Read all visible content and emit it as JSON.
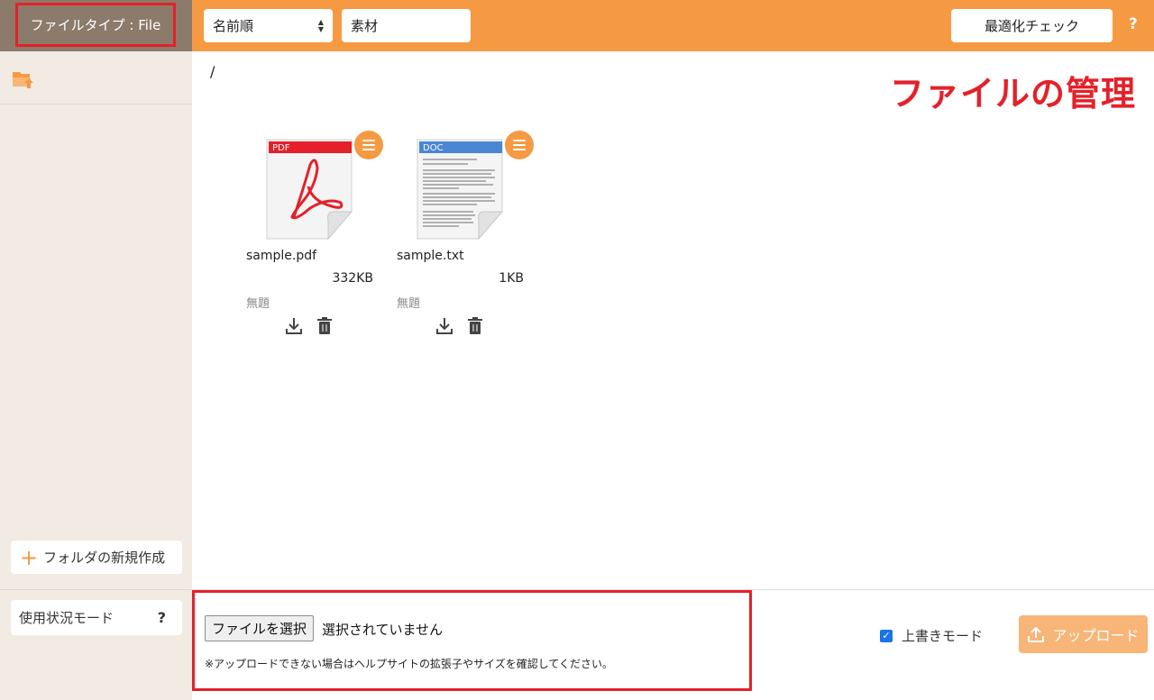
{
  "sidebar": {
    "file_type_label": "ファイルタイプ : File",
    "upload_folder_icon": "folder-upload-icon",
    "new_folder_label": "フォルダの新規作成",
    "usage_mode_label": "使用状況モード",
    "usage_help": "?"
  },
  "toolbar": {
    "sort_value": "名前順",
    "filter_value": "素材",
    "optimize_label": "最適化チェック",
    "help": "?"
  },
  "main": {
    "path": "/",
    "heading": "ファイルの管理",
    "files": [
      {
        "name": "sample.pdf",
        "size": "332KB",
        "title": "無題",
        "thumb_label": "PDF",
        "icon": "pdf-file-icon"
      },
      {
        "name": "sample.txt",
        "size": "1KB",
        "title": "無題",
        "thumb_label": "DOC",
        "icon": "doc-file-icon"
      }
    ]
  },
  "upload": {
    "choose_label": "ファイルを選択",
    "choose_status": "選択されていません",
    "note": "※アップロードできない場合はヘルプサイトの拡張子やサイズを確認してください。",
    "overwrite_label": "上書きモード",
    "overwrite_checked": true,
    "upload_label": "アップロード"
  },
  "colors": {
    "accent": "#f59a43",
    "sidebar_bg": "#f1ebe4",
    "filetype_bg": "#8c7b6a",
    "highlight_red": "#e4212a"
  }
}
